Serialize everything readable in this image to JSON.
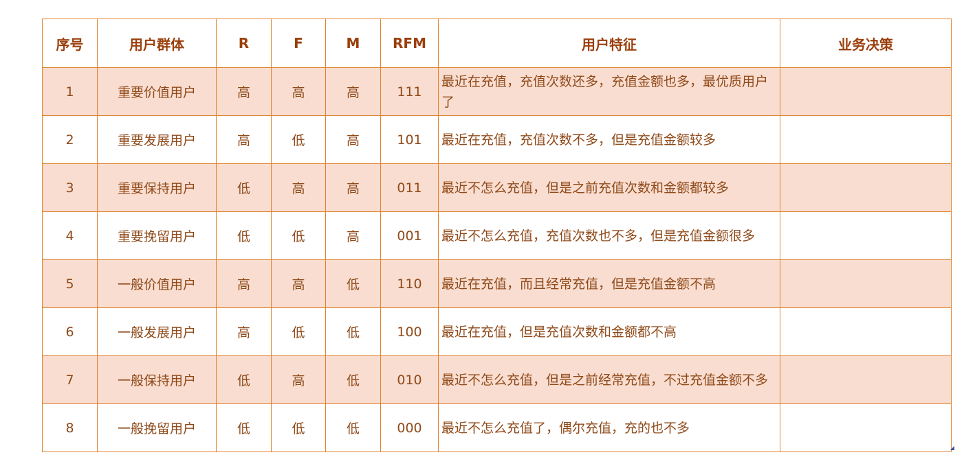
{
  "table": {
    "headers": {
      "index": "序号",
      "group": "用户群体",
      "r": "R",
      "f": "F",
      "m": "M",
      "rfm": "RFM",
      "feature": "用户特征",
      "decision": "业务决策"
    },
    "rows": [
      {
        "index": "1",
        "group": "重要价值用户",
        "r": "高",
        "f": "高",
        "m": "高",
        "rfm": "111",
        "feature": "最近在充值，充值次数还多，充值金额也多，最优质用户了",
        "decision": ""
      },
      {
        "index": "2",
        "group": "重要发展用户",
        "r": "高",
        "f": "低",
        "m": "高",
        "rfm": "101",
        "feature": "最近在充值，充值次数不多，但是充值金额较多",
        "decision": ""
      },
      {
        "index": "3",
        "group": "重要保持用户",
        "r": "低",
        "f": "高",
        "m": "高",
        "rfm": "011",
        "feature": "最近不怎么充值，但是之前充值次数和金额都较多",
        "decision": ""
      },
      {
        "index": "4",
        "group": "重要挽留用户",
        "r": "低",
        "f": "低",
        "m": "高",
        "rfm": "001",
        "feature": "最近不怎么充值，充值次数也不多，但是充值金额很多",
        "decision": ""
      },
      {
        "index": "5",
        "group": "一般价值用户",
        "r": "高",
        "f": "高",
        "m": "低",
        "rfm": "110",
        "feature": "最近在充值，而且经常充值，但是充值金额不高",
        "decision": ""
      },
      {
        "index": "6",
        "group": "一般发展用户",
        "r": "高",
        "f": "低",
        "m": "低",
        "rfm": "100",
        "feature": "最近在充值，但是充值次数和金额都不高",
        "decision": ""
      },
      {
        "index": "7",
        "group": "一般保持用户",
        "r": "低",
        "f": "高",
        "m": "低",
        "rfm": "010",
        "feature": "最近不怎么充值，但是之前经常充值，不过充值金额不多",
        "decision": ""
      },
      {
        "index": "8",
        "group": "一般挽留用户",
        "r": "低",
        "f": "低",
        "m": "低",
        "rfm": "000",
        "feature": "最近不怎么充值了，偶尔充值，充的也不多",
        "decision": ""
      }
    ]
  },
  "colors": {
    "border": "#e0822e",
    "header_text": "#9b3f0c",
    "body_text": "#8f4a1a",
    "odd_row_bg": "#f9ddd0",
    "even_row_bg": "#ffffff"
  }
}
